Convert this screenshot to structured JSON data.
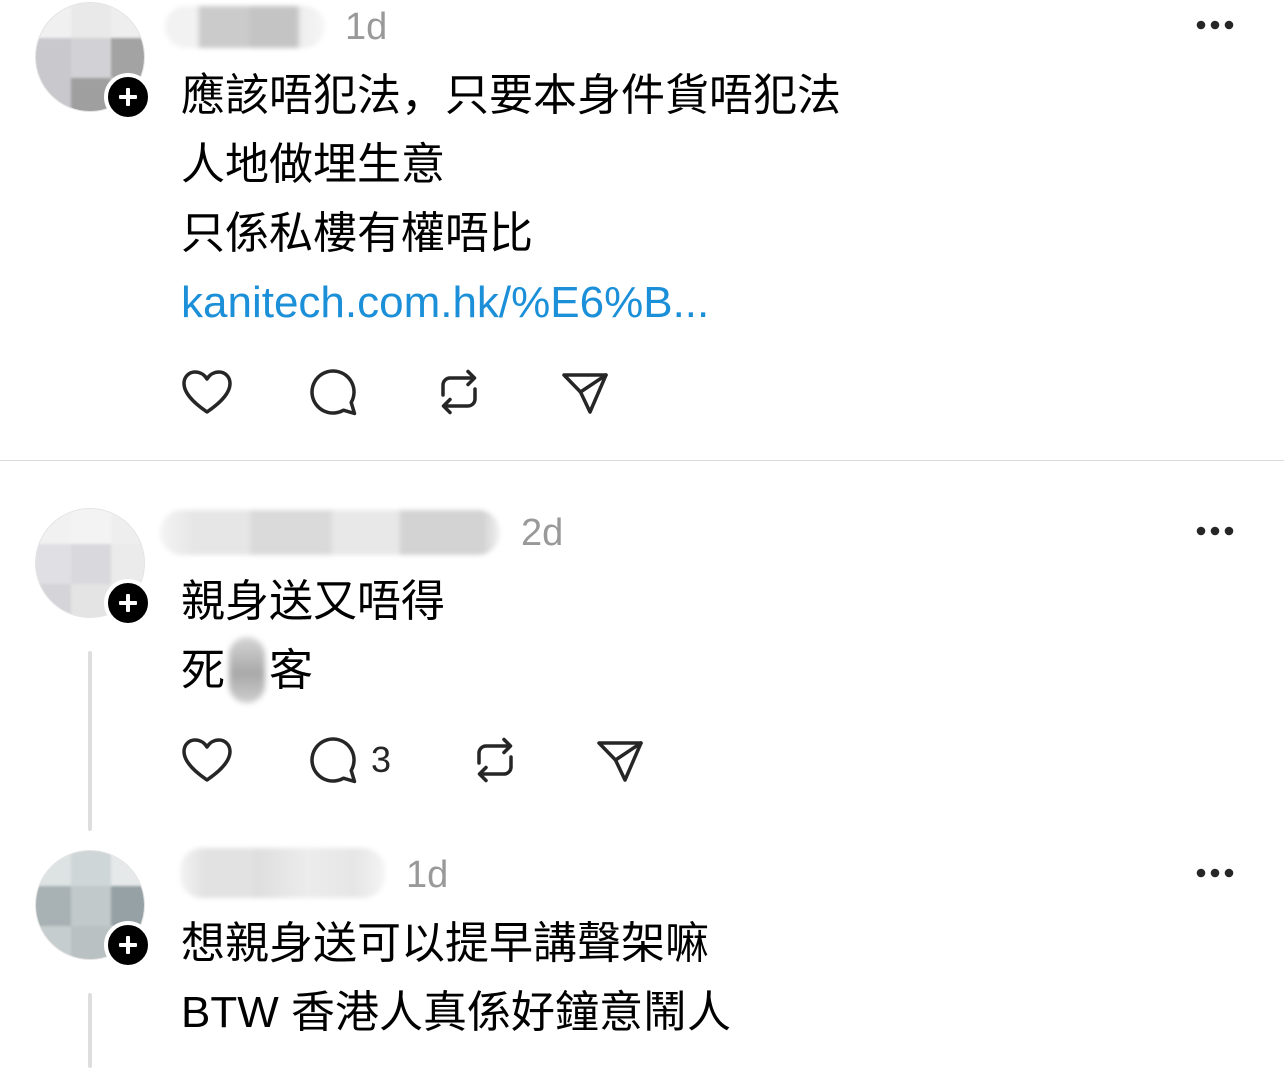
{
  "colors": {
    "background": "#ffffff",
    "text": "#000000",
    "secondary_text": "#999999",
    "link": "#1c8fd9",
    "icon": "#262626",
    "divider": "#dbdbdb",
    "thread_line": "#dedede",
    "follow_badge": "#000000"
  },
  "icons": {
    "follow": "plus-icon",
    "more": "more-icon",
    "like": "heart-icon",
    "reply": "comment-icon",
    "repost": "repost-icon",
    "share": "share-icon"
  },
  "posts": [
    {
      "time": "1d",
      "lines": [
        "應該唔犯法，只要本身件貨唔犯法",
        "人地做埋生意",
        "只係私樓有權唔比"
      ],
      "link": "kanitech.com.hk/%E6%B..."
    },
    {
      "time": "2d",
      "lines": [
        "親身送又唔得"
      ],
      "redacted_line": {
        "before": "死",
        "after": "客"
      },
      "reply_count": "3"
    },
    {
      "time": "1d",
      "lines": [
        "想親身送可以提早講聲架嘛",
        "BTW 香港人真係好鐘意鬧人"
      ]
    }
  ]
}
